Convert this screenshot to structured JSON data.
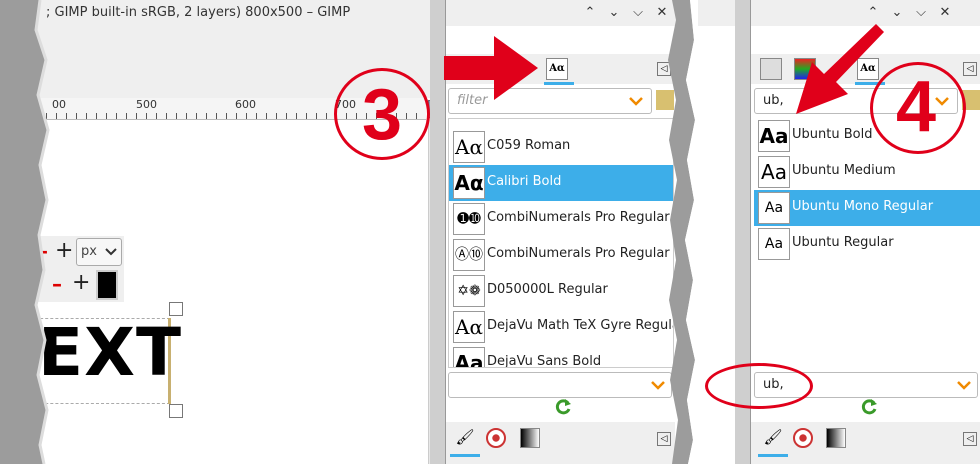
{
  "left_window": {
    "title": "; GIMP built-in sRGB, 2 layers) 800x500 – GIMP",
    "ruler_labels": [
      "00",
      "500",
      "600",
      "700"
    ],
    "tool_options": {
      "unit": "px"
    },
    "canvas_text": "EXT"
  },
  "annotations": {
    "step3": "3",
    "step4": "4"
  },
  "panel3": {
    "filter_placeholder": "filter",
    "fonts": [
      {
        "preview": "Aα",
        "name": "C059 Roman",
        "selected": false
      },
      {
        "preview": "Aα",
        "name": "Calibri Bold",
        "selected": true
      },
      {
        "preview": "➊➓",
        "name": "CombiNumerals Pro Regular",
        "selected": false
      },
      {
        "preview": "Ⓐ⑩",
        "name": "CombiNumerals Pro Regular",
        "selected": false
      },
      {
        "preview": "✡❁",
        "name": "D050000L Regular",
        "selected": false
      },
      {
        "preview": "Aα",
        "name": "DejaVu Math TeX Gyre Regular",
        "selected": false
      },
      {
        "preview": "Aa",
        "name": "DejaVu Sans Bold",
        "selected": false
      }
    ]
  },
  "panel4": {
    "filter_value": "ub,",
    "fonts": [
      {
        "preview": "Aa",
        "name": "Ubuntu Bold",
        "selected": false
      },
      {
        "preview": "Aa",
        "name": "Ubuntu Medium",
        "selected": false
      },
      {
        "preview": "Aa",
        "name": "Ubuntu Mono Regular",
        "selected": true
      },
      {
        "preview": "Aa",
        "name": "Ubuntu Regular",
        "selected": false
      }
    ],
    "tag_value": "ub,"
  },
  "colors": {
    "accent": "#3daee9",
    "annotation_red": "#e0001a",
    "refresh_green": "#3a9a2a"
  }
}
